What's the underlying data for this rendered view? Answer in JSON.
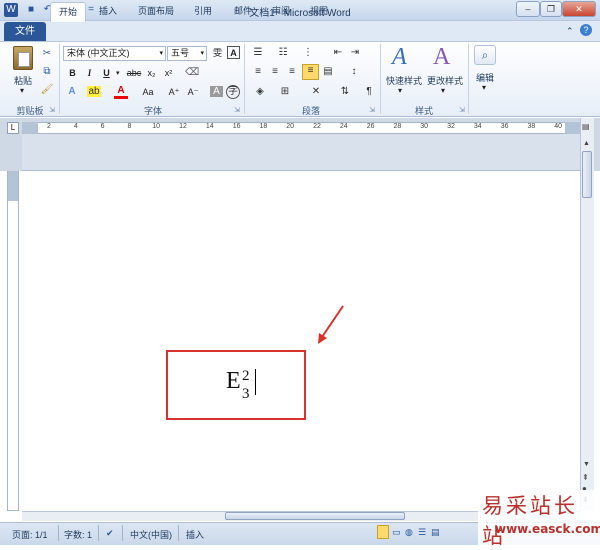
{
  "window": {
    "title": "文档1 - Microsoft Word",
    "min": "–",
    "restore": "❐",
    "close": "✕"
  },
  "qat": {
    "word_icon": "W",
    "save_icon": "■",
    "undo_icon": "↶",
    "redo_icon": "↻",
    "more_icon": "="
  },
  "tabs": {
    "file": "文件",
    "items": [
      "开始",
      "插入",
      "页面布局",
      "引用",
      "邮件",
      "审阅",
      "视图"
    ]
  },
  "ribbon": {
    "clipboard": {
      "paste_label": "粘贴",
      "group_label": "剪贴板"
    },
    "font": {
      "font_name": "宋体 (中文正文)",
      "font_size": "五号",
      "wen_label": "雯",
      "a_label": "A",
      "bold": "B",
      "italic": "I",
      "underline": "U",
      "strike": "abc",
      "subscript": "x₂",
      "superscript": "x²",
      "grow": "A⁺",
      "shrink": "A⁻",
      "aa": "Aa",
      "group_label": "字体"
    },
    "paragraph": {
      "group_label": "段落"
    },
    "styles": {
      "quick_styles": "快速样式",
      "change_styles": "更改样式",
      "group_label": "样式"
    },
    "editing": {
      "label": "编辑"
    }
  },
  "ruler": {
    "ticks": [
      "2",
      "4",
      "6",
      "8",
      "10",
      "12",
      "14",
      "16",
      "18",
      "20",
      "22",
      "24",
      "26",
      "28",
      "30",
      "32",
      "34",
      "36",
      "38",
      "40"
    ]
  },
  "document": {
    "base": "E",
    "superscript": "2",
    "subscript": "3"
  },
  "statusbar": {
    "page": "页面: 1/1",
    "words": "字数: 1",
    "language": "中文(中国)",
    "mode": "插入"
  },
  "watermark": {
    "text": "易采站长站",
    "url": "www.easck.com"
  },
  "colors": {
    "accent": "#2b579a",
    "highlight": "#d9312b"
  }
}
